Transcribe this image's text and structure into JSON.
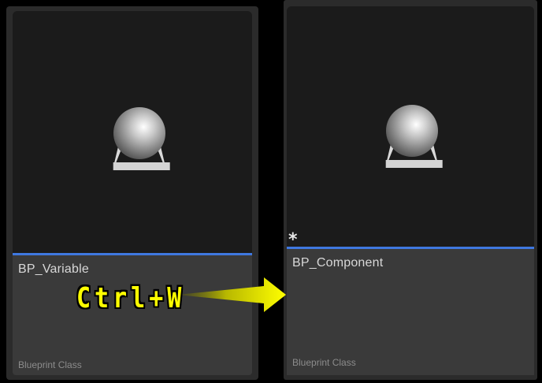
{
  "assets": [
    {
      "name": "BP_Variable",
      "type": "Blueprint Class",
      "icon": "blueprint-sphere-icon",
      "modified": false
    },
    {
      "name": "BP_Component",
      "type": "Blueprint Class",
      "icon": "blueprint-sphere-icon",
      "modified": true,
      "modified_marker": "*"
    }
  ],
  "annotation": {
    "shortcut": "Ctrl+W",
    "shortcut_color": "#ffff00",
    "arrow_icon": "arrow-right-icon"
  },
  "colors": {
    "accent": "#3f78e0",
    "card_background": "#3a3a3a",
    "thumbnail_background": "#1b1b1b"
  }
}
